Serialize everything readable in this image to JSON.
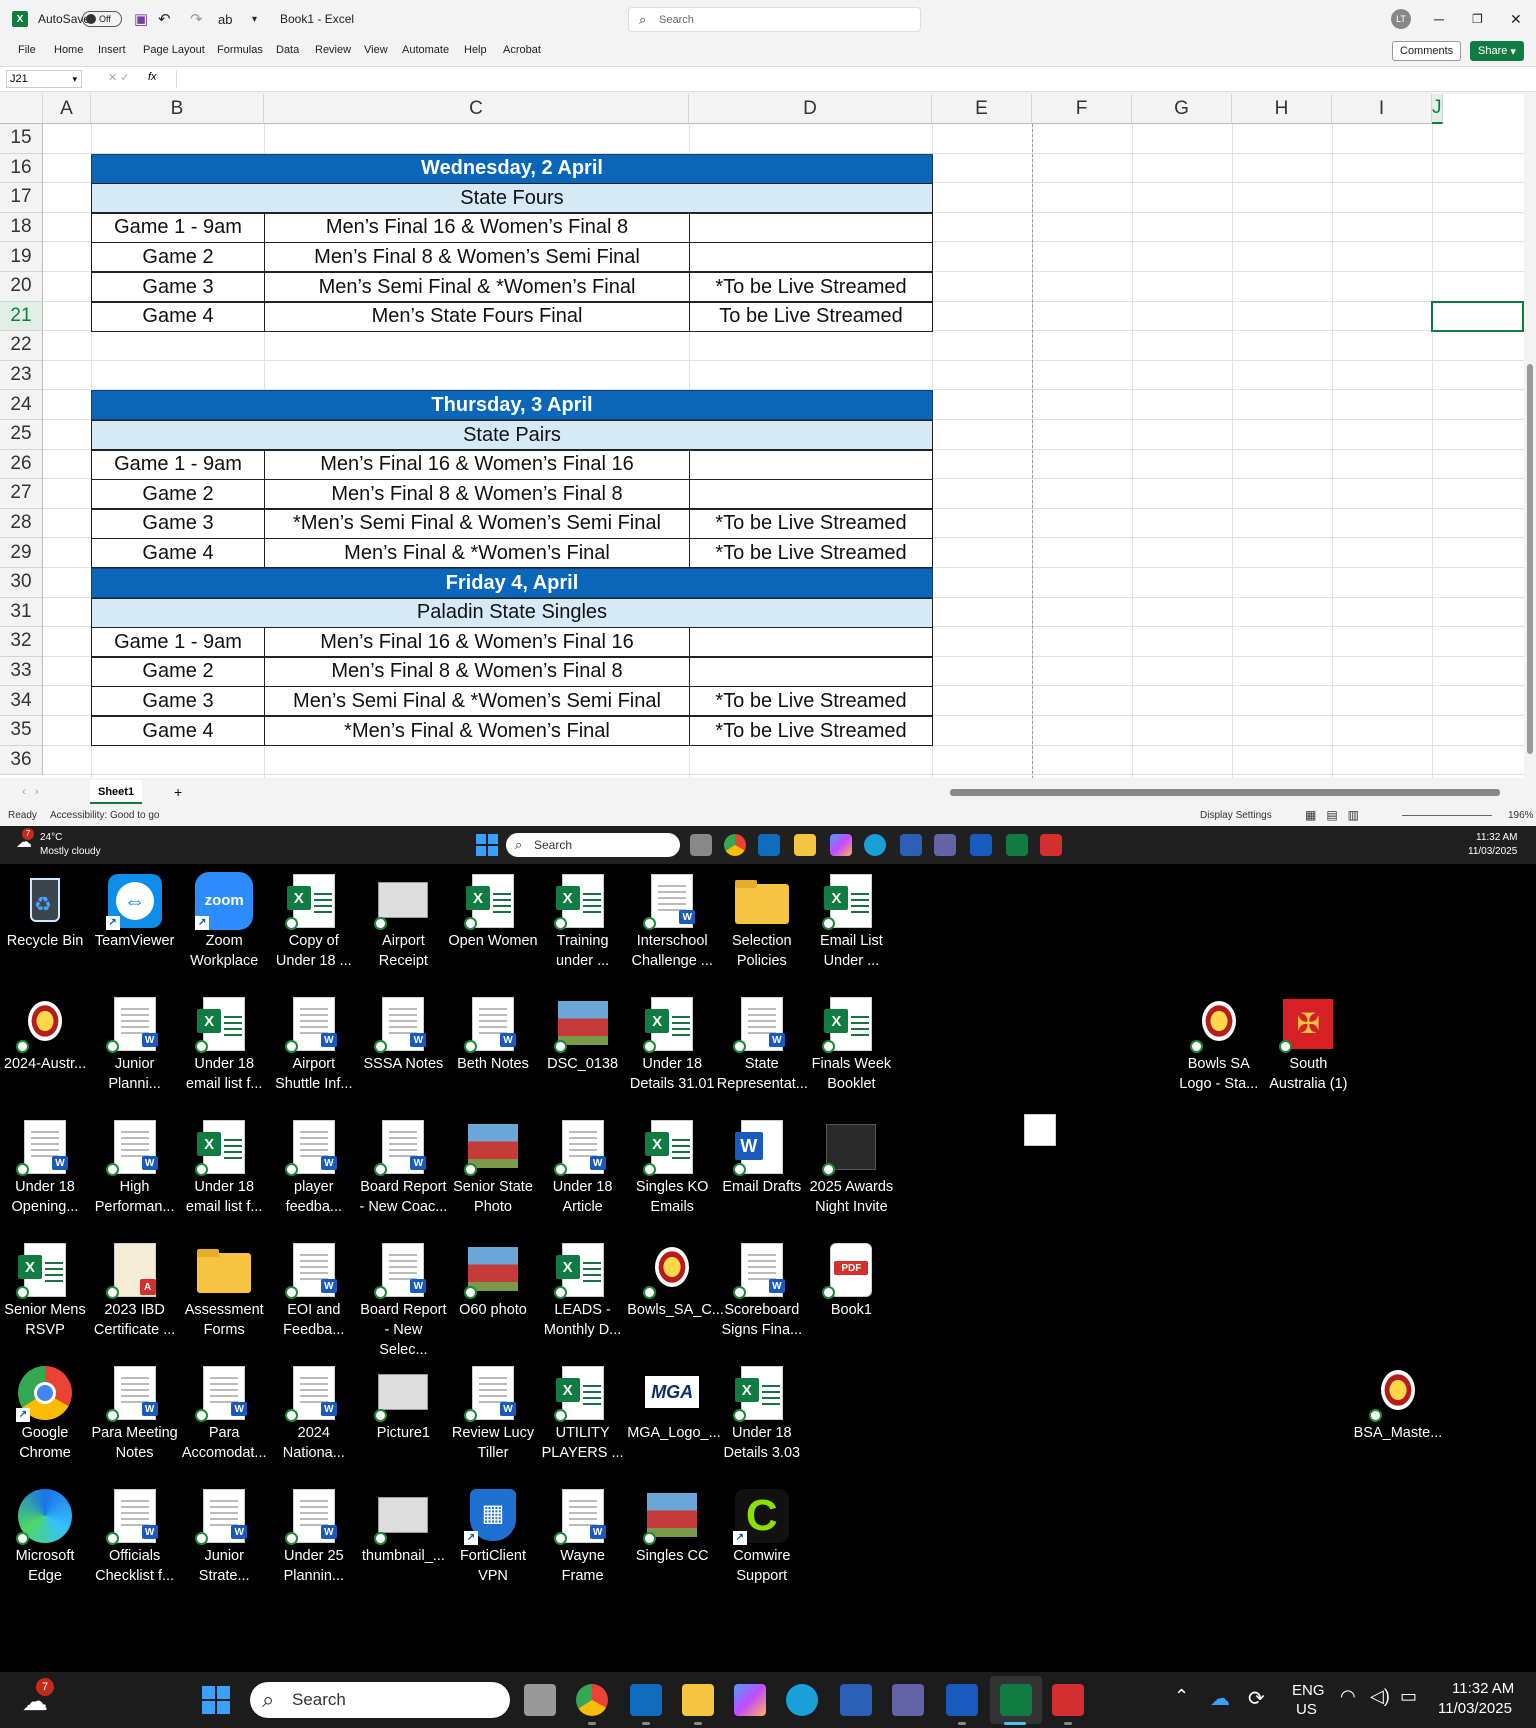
{
  "excel": {
    "autosave_label": "AutoSave",
    "autosave_state": "Off",
    "doc_title": "Book1  -  Excel",
    "search_placeholder": "Search",
    "user_initials": "LT",
    "menu": [
      "File",
      "Home",
      "Insert",
      "Page Layout",
      "Formulas",
      "Data",
      "Review",
      "View",
      "Automate",
      "Help",
      "Acrobat"
    ],
    "comments_label": "Comments",
    "share_label": "Share",
    "name_box": "J21",
    "fx": "fx",
    "columns": [
      "A",
      "B",
      "C",
      "D",
      "E",
      "F",
      "G",
      "H",
      "I",
      "J"
    ],
    "rows": [
      "15",
      "16",
      "17",
      "18",
      "19",
      "20",
      "21",
      "22",
      "23",
      "24",
      "25",
      "26",
      "27",
      "28",
      "29",
      "30",
      "31",
      "32",
      "33",
      "34",
      "35",
      "36"
    ],
    "schedule": [
      {
        "day": "Wednesday, 2 April",
        "event": "State Fours",
        "games": [
          [
            "Game 1 - 9am",
            "Men’s Final 16 & Women’s Final 8",
            ""
          ],
          [
            "Game 2",
            "Men’s Final 8 & Women’s Semi Final",
            ""
          ],
          [
            "Game 3",
            "Men’s Semi Final & *Women’s Final",
            "*To be Live Streamed"
          ],
          [
            "Game 4",
            "Men’s State Fours Final",
            "To be Live Streamed"
          ]
        ]
      },
      {
        "day": "Thursday, 3 April",
        "event": "State Pairs",
        "games": [
          [
            "Game 1 - 9am",
            "Men’s Final 16 & Women’s Final 16",
            ""
          ],
          [
            "Game 2",
            "Men’s Final 8 & Women’s Final 8",
            ""
          ],
          [
            "Game 3",
            "*Men’s Semi Final & Women’s Semi Final",
            "*To be Live Streamed"
          ],
          [
            "Game 4",
            "Men’s Final & *Women’s Final",
            "*To be Live Streamed"
          ]
        ]
      },
      {
        "day": "Friday 4, April",
        "event": "Paladin State Singles",
        "games": [
          [
            "Game 1 - 9am",
            "Men’s Final 16 & Women’s Final 16",
            ""
          ],
          [
            "Game 2",
            "Men’s Final 8 & Women’s Final 8",
            ""
          ],
          [
            "Game 3",
            "Men’s Semi Final & *Women’s Semi Final",
            "*To be Live Streamed"
          ],
          [
            "Game 4",
            "*Men’s Final & Women’s Final",
            "*To be Live Streamed"
          ]
        ]
      }
    ],
    "sheet_tab": "Sheet1",
    "add_sheet": "+",
    "status_ready": "Ready",
    "status_access": "Accessibility: Good to go",
    "display_settings": "Display Settings",
    "zoom": "196%"
  },
  "taskbar_top": {
    "temp": "24°C",
    "weather": "Mostly cloudy",
    "search": "Search",
    "time": "11:32 AM",
    "date": "11/03/2025",
    "notif": "7"
  },
  "desktop": [
    {
      "label": "Recycle Bin",
      "kind": "bin"
    },
    {
      "label": "TeamViewer",
      "kind": "tv"
    },
    {
      "label": "Zoom Workplace",
      "kind": "zoom"
    },
    {
      "label": "Copy of Under 18 ...",
      "kind": "excel"
    },
    {
      "label": "Airport Receipt",
      "kind": "img"
    },
    {
      "label": "Open Women",
      "kind": "excel"
    },
    {
      "label": "Training under ...",
      "kind": "excel"
    },
    {
      "label": "Interschool Challenge ...",
      "kind": "word"
    },
    {
      "label": "Selection Policies",
      "kind": "folder"
    },
    {
      "label": "Email List Under ...",
      "kind": "excel"
    },
    {
      "label": "2024-Austr...",
      "kind": "logo"
    },
    {
      "label": "Junior Planni...",
      "kind": "word"
    },
    {
      "label": "Under 18 email list f...",
      "kind": "excel"
    },
    {
      "label": "Airport Shuttle Inf...",
      "kind": "word"
    },
    {
      "label": "SSSA Notes",
      "kind": "word"
    },
    {
      "label": "Beth Notes",
      "kind": "word"
    },
    {
      "label": "DSC_0138",
      "kind": "photo"
    },
    {
      "label": "Under 18 Details 31.01",
      "kind": "excel"
    },
    {
      "label": "State Representat...",
      "kind": "word"
    },
    {
      "label": "Finals Week Booklet",
      "kind": "excel"
    },
    {
      "label": "Under 18 Opening...",
      "kind": "word"
    },
    {
      "label": "High Performan...",
      "kind": "word"
    },
    {
      "label": "Under 18 email list f...",
      "kind": "excel"
    },
    {
      "label": "player feedba...",
      "kind": "word"
    },
    {
      "label": "Board Report - New Coac...",
      "kind": "word"
    },
    {
      "label": "Senior State Photo",
      "kind": "photo"
    },
    {
      "label": "Under 18 Article",
      "kind": "word"
    },
    {
      "label": "Singles KO Emails",
      "kind": "excel"
    },
    {
      "label": "Email Drafts",
      "kind": "wordapp"
    },
    {
      "label": "2025 Awards Night Invite",
      "kind": "dark"
    },
    {
      "label": "Senior Mens RSVP",
      "kind": "excel"
    },
    {
      "label": "2023 IBD Certificate ...",
      "kind": "pdfdoc"
    },
    {
      "label": "Assessment Forms",
      "kind": "folder"
    },
    {
      "label": "EOI and Feedba...",
      "kind": "word"
    },
    {
      "label": "Board Report - New Selec...",
      "kind": "word"
    },
    {
      "label": "O60 photo",
      "kind": "photo"
    },
    {
      "label": "LEADS - Monthly D...",
      "kind": "excel"
    },
    {
      "label": "Bowls_SA_C...",
      "kind": "logo"
    },
    {
      "label": "Scoreboard Signs Fina...",
      "kind": "word"
    },
    {
      "label": "Book1",
      "kind": "pdf"
    },
    {
      "label": "Google Chrome",
      "kind": "chrome"
    },
    {
      "label": "Para Meeting Notes",
      "kind": "word"
    },
    {
      "label": "Para Accomodat...",
      "kind": "word"
    },
    {
      "label": "2024 Nationa...",
      "kind": "word"
    },
    {
      "label": "Picture1",
      "kind": "img"
    },
    {
      "label": "Review Lucy Tiller",
      "kind": "word"
    },
    {
      "label": "UTILITY PLAYERS ...",
      "kind": "excel"
    },
    {
      "label": "MGA_Logo_...",
      "kind": "mga"
    },
    {
      "label": "Under 18 Details 3.03",
      "kind": "excel"
    },
    {
      "label": "Microsoft Edge",
      "kind": "edge"
    },
    {
      "label": "Officials Checklist f...",
      "kind": "word"
    },
    {
      "label": "Junior Strate...",
      "kind": "word"
    },
    {
      "label": "Under 25 Plannin...",
      "kind": "word"
    },
    {
      "label": "thumbnail_...",
      "kind": "img"
    },
    {
      "label": "FortiClient VPN",
      "kind": "forti"
    },
    {
      "label": "Wayne Frame",
      "kind": "word"
    },
    {
      "label": "Singles CC",
      "kind": "photo"
    },
    {
      "label": "Comwire Support",
      "kind": "comwire"
    },
    {
      "label": "Bowls SA Logo - Sta...",
      "kind": "logo"
    },
    {
      "label": "South Australia (1)",
      "kind": "sa"
    },
    {
      "label": "BSA_Maste...",
      "kind": "logo"
    }
  ],
  "taskbar_bottom": {
    "search": "Search",
    "lang1": "ENG",
    "lang2": "US",
    "time": "11:32 AM",
    "date": "11/03/2025",
    "notif": "7"
  }
}
